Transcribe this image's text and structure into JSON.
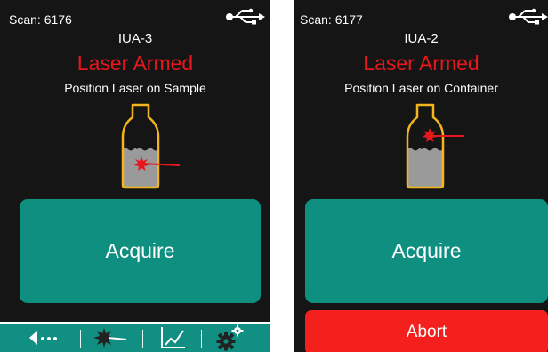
{
  "left_screen": {
    "scan_label": "Scan: 6176",
    "device_name": "IUA-3",
    "status": "Laser Armed",
    "instruction": "Position Laser on Sample",
    "acquire_label": "Acquire",
    "usb_icon": "usb-icon",
    "illustration": "bottle-laser-on-sample",
    "toolbar": [
      {
        "icon": "back-dots-icon"
      },
      {
        "icon": "laser-icon"
      },
      {
        "icon": "chart-icon"
      },
      {
        "icon": "settings-gears-icon"
      }
    ]
  },
  "right_screen": {
    "scan_label": "Scan: 6177",
    "device_name": "IUA-2",
    "status": "Laser Armed",
    "instruction": "Position Laser on Container",
    "acquire_label": "Acquire",
    "abort_label": "Abort",
    "usb_icon": "usb-icon",
    "illustration": "bottle-laser-on-container"
  },
  "colors": {
    "background": "#151515",
    "status_red": "#e8171d",
    "acquire_teal": "#0e8f80",
    "abort_red": "#f3201e",
    "bottle_outline": "#f2b51d",
    "liquid": "#9a9a9a"
  }
}
